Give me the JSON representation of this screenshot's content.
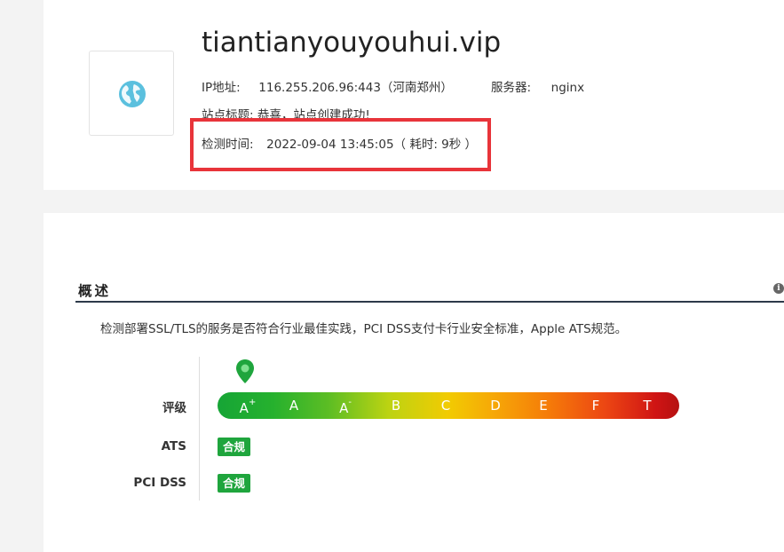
{
  "site": {
    "domain": "tiantianyouyouhui.vip",
    "ip_label": "IP地址:",
    "ip_value": "116.255.206.96:443（河南郑州）",
    "server_label": "服务器:",
    "server_value": "nginx",
    "title_label": "站点标题:",
    "title_value": "恭喜，站点创建成功!",
    "time_label": "检测时间:",
    "time_value": "2022-09-04 13:45:05（ 耗时: 9秒 ）",
    "icon": "globe-icon"
  },
  "overview": {
    "title": "概述",
    "description": "检测部署SSL/TLS的服务是否符合行业最佳实践，PCI DSS支付卡行业安全标准，Apple ATS规范。",
    "rating_label": "评级",
    "grades": [
      "A",
      "A",
      "A",
      "B",
      "C",
      "D",
      "E",
      "F",
      "T"
    ],
    "grade_marks": {
      "a_plus": "+",
      "a_minus": "-"
    },
    "current_grade": "A+",
    "ats_label": "ATS",
    "ats_status": "合规",
    "pci_label": "PCI DSS",
    "pci_status": "合规",
    "info_icon": "info-icon"
  },
  "colors": {
    "highlight": "#e8343a",
    "compliant": "#1fa53d",
    "marker": "#1fa53d",
    "globe": "#5bc0de"
  }
}
